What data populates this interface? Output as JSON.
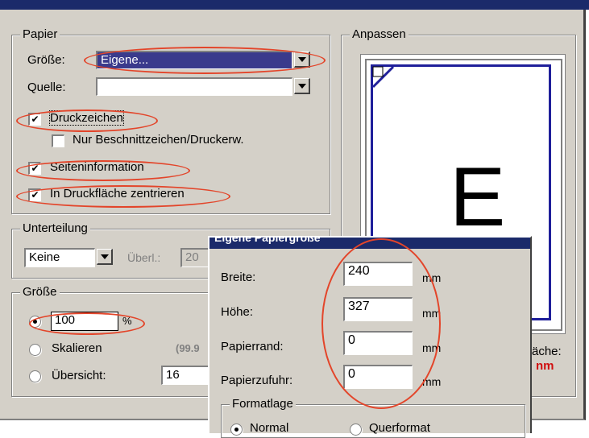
{
  "papier": {
    "legend": "Papier",
    "groesse_label": "Größe:",
    "groesse_value": "Eigene...",
    "quelle_label": "Quelle:",
    "quelle_value": "",
    "druckzeichen": {
      "label": "Druckzeichen",
      "checked": true
    },
    "beschnitt": {
      "label": "Nur Beschnittzeichen/Druckerw.",
      "checked": false
    },
    "seiteninfo": {
      "label": "Seiteninformation",
      "checked": true
    },
    "zentrieren": {
      "label": "In Druckfläche zentrieren",
      "checked": true
    }
  },
  "unterteilung": {
    "legend": "Unterteilung",
    "value": "Keine",
    "ueberl_label": "Überl.:",
    "ueberl_value": "20"
  },
  "groesse": {
    "legend": "Größe",
    "percent_value": "100",
    "percent_unit": "%",
    "skalieren_label": "Skalieren",
    "skalieren_value": "(99.9",
    "uebersicht_label": "Übersicht:",
    "uebersicht_value": "16"
  },
  "anpassen": {
    "legend": "Anpassen",
    "preview_letter": "E",
    "flaeche_text": "äche:",
    "mm_text": "nm"
  },
  "popup": {
    "title": "Eigene Papiergröße",
    "rows": [
      {
        "label": "Breite:",
        "value": "240",
        "unit": "mm"
      },
      {
        "label": "Höhe:",
        "value": "327",
        "unit": "mm"
      },
      {
        "label": "Papierrand:",
        "value": "0",
        "unit": "mm"
      },
      {
        "label": "Papierzufuhr:",
        "value": "0",
        "unit": "mm"
      }
    ],
    "formatlage_legend": "Formatlage",
    "normal_label": "Normal",
    "querformat_label": "Querformat"
  },
  "colors": {
    "highlight_circle": "#e3452a",
    "selection": "#3a3a8c",
    "preview_blue": "#1f1f9a",
    "warn_red": "#d01010"
  }
}
